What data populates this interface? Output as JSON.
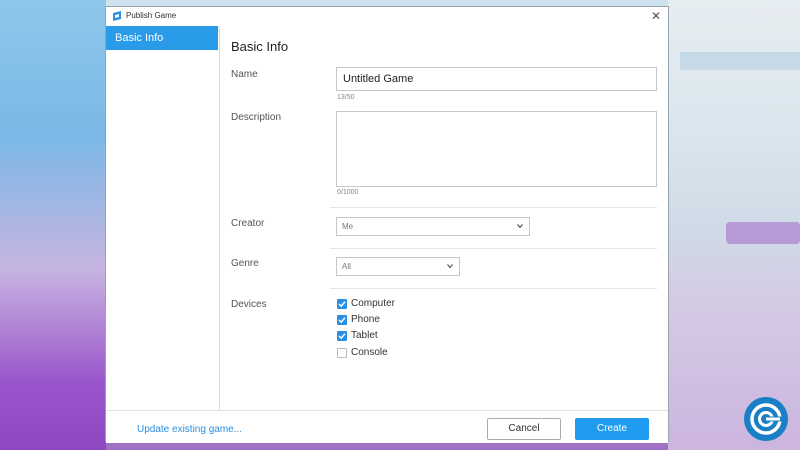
{
  "window": {
    "title": "Publish Game",
    "close_glyph": "✕"
  },
  "sidebar": {
    "items": [
      {
        "label": "Basic Info",
        "selected": true
      }
    ]
  },
  "main": {
    "heading": "Basic Info",
    "name": {
      "label": "Name",
      "value": "Untitled Game",
      "counter": "13/50"
    },
    "description": {
      "label": "Description",
      "value": "",
      "counter": "0/1000"
    },
    "creator": {
      "label": "Creator",
      "selected": "Me"
    },
    "genre": {
      "label": "Genre",
      "selected": "All"
    },
    "devices": {
      "label": "Devices",
      "options": [
        {
          "label": "Computer",
          "checked": true
        },
        {
          "label": "Phone",
          "checked": true
        },
        {
          "label": "Tablet",
          "checked": true
        },
        {
          "label": "Console",
          "checked": false
        }
      ]
    }
  },
  "footer": {
    "update_link": "Update existing game...",
    "cancel_label": "Cancel",
    "create_label": "Create"
  },
  "colors": {
    "accent": "#2a9be8",
    "create_button": "#1f9cf0",
    "link": "#2a8fe0"
  },
  "icons": [
    "app-icon",
    "close-icon",
    "chevron-down-icon",
    "checkmark-icon",
    "gamer-logo-icon"
  ]
}
